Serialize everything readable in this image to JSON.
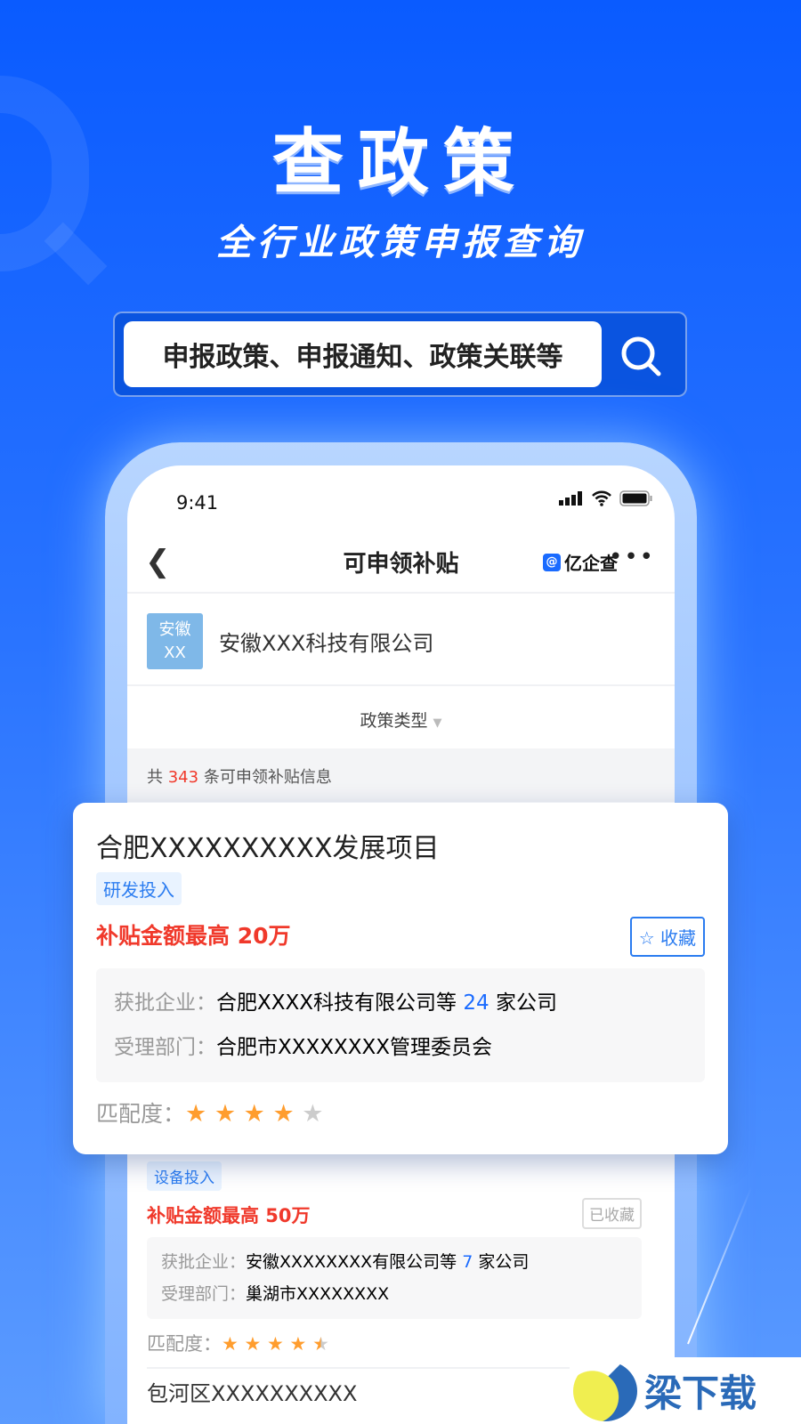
{
  "hero": {
    "title": "查政策",
    "subtitle": "全行业政策申报查询"
  },
  "search": {
    "placeholder": "申报政策、申报通知、政策关联等",
    "icon": "search-icon"
  },
  "phone": {
    "status": {
      "time": "9:41"
    },
    "nav": {
      "title": "可申领补贴",
      "brand": "亿企查",
      "more": "•••"
    },
    "company": {
      "avatar_line1": "安徽",
      "avatar_line2": "XX",
      "name": "安徽XXX科技有限公司"
    },
    "filter": {
      "label": "政策类型"
    },
    "count": {
      "prefix": "共",
      "value": "343",
      "suffix": "条可申领补贴信息"
    },
    "item2": {
      "tag": "设备投入",
      "amount": "补贴金额最高 50万",
      "saved_label": "已收藏",
      "approved_label": "获批企业：",
      "approved_prefix": "安徽XXXXXXXX有限公司等",
      "approved_count": "7",
      "approved_suffix": "家公司",
      "dept_label": "受理部门：",
      "dept": "巢湖市XXXXXXXX",
      "match_label": "匹配度：",
      "match_rating": 4.5
    },
    "item3": {
      "title": "包河区XXXXXXXXXX"
    }
  },
  "card": {
    "title": "合肥XXXXXXXXXX发展项目",
    "tag": "研发投入",
    "amount": "补贴金额最高 20万",
    "save_label": "收藏",
    "approved_label": "获批企业：",
    "approved_prefix": "合肥XXXX科技有限公司等",
    "approved_count": "24",
    "approved_suffix": "家公司",
    "dept_label": "受理部门：",
    "dept": "合肥市XXXXXXXX管理委员会",
    "match_label": "匹配度：",
    "match_rating": 4
  },
  "watermark": {
    "text": "梁下载"
  },
  "colors": {
    "accent": "#1a6bff",
    "red": "#f0392b",
    "star": "#ff9d2e"
  }
}
